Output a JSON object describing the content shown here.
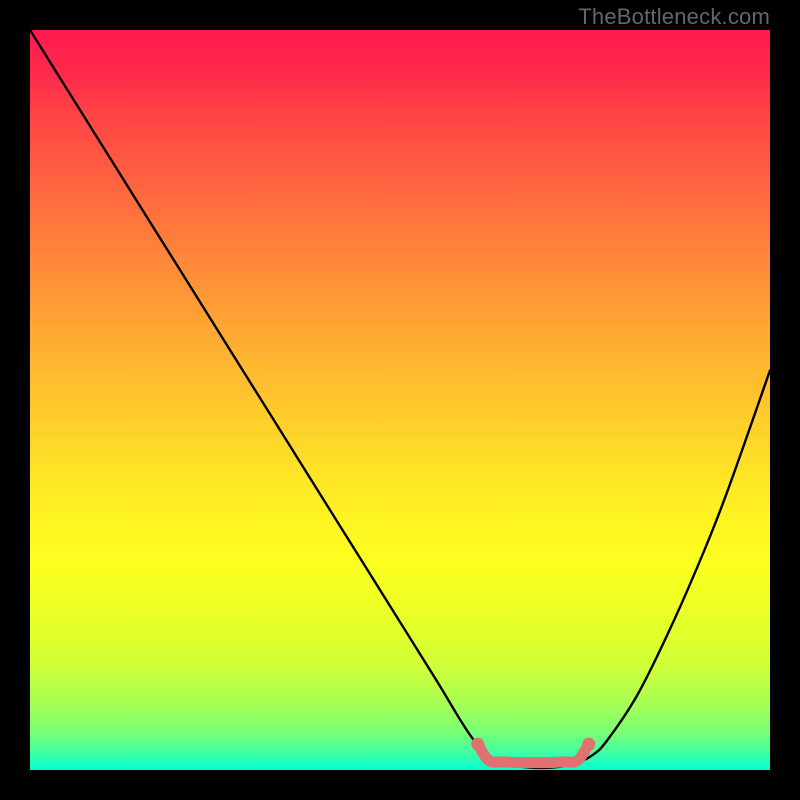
{
  "watermark": "TheBottleneck.com",
  "chart_data": {
    "type": "line",
    "title": "",
    "xlabel": "",
    "ylabel": "",
    "xlim": [
      0,
      100
    ],
    "ylim": [
      0,
      100
    ],
    "grid": false,
    "series": [
      {
        "name": "bottleneck-curve",
        "x": [
          0,
          5,
          10,
          15,
          20,
          25,
          30,
          35,
          40,
          45,
          50,
          55,
          58,
          60,
          62,
          64,
          66,
          68,
          70,
          72,
          74,
          76,
          78,
          82,
          86,
          90,
          94,
          100
        ],
        "y": [
          100,
          92,
          84,
          76,
          68,
          60,
          52,
          44,
          36,
          28,
          20,
          12,
          7,
          4,
          2,
          1,
          0.5,
          0.3,
          0.3,
          0.5,
          1,
          2,
          4,
          10,
          18,
          27,
          37,
          54
        ]
      }
    ],
    "markers": {
      "name": "highlight-band",
      "color": "#e17070",
      "points": [
        {
          "x": 60.5,
          "y": 3.5
        },
        {
          "x": 62,
          "y": 1.3
        },
        {
          "x": 64,
          "y": 1.1
        },
        {
          "x": 66,
          "y": 1.0
        },
        {
          "x": 68,
          "y": 1.0
        },
        {
          "x": 70,
          "y": 1.0
        },
        {
          "x": 72,
          "y": 1.1
        },
        {
          "x": 74,
          "y": 1.3
        },
        {
          "x": 75.5,
          "y": 3.5
        }
      ]
    },
    "background_gradient": {
      "top": "#ff1a50",
      "mid": "#ffe426",
      "bottom": "#00ffd8"
    }
  }
}
